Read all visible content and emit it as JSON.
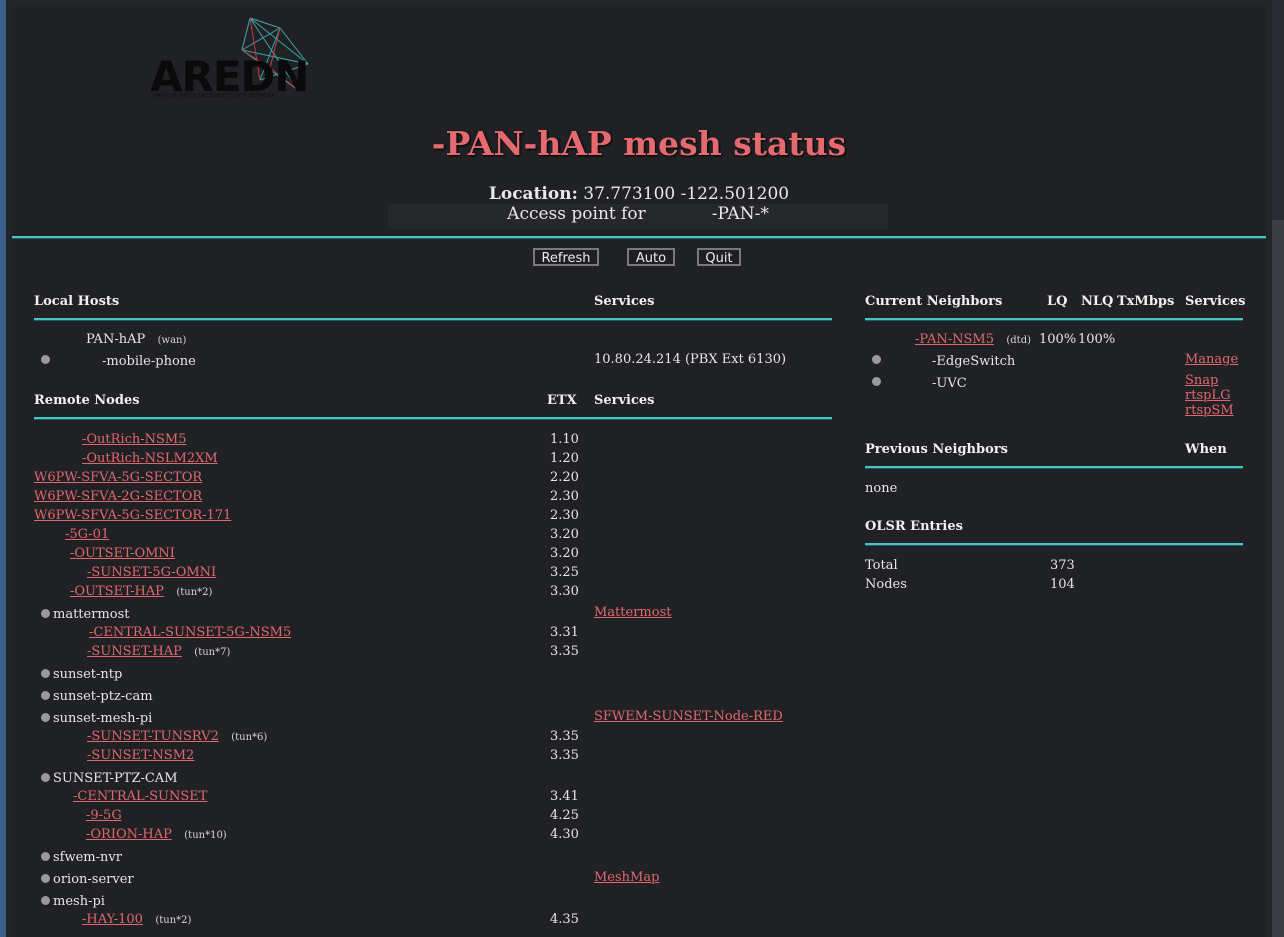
{
  "logo": {
    "name": "AREDN",
    "tagline": "AMATEUR RADIO EMERGENCY DATA NETWORK"
  },
  "title": {
    "prefix": "",
    "text": "-PAN-hAP mesh status"
  },
  "location": {
    "label": "Location:",
    "value": "37.773100 -122.501200"
  },
  "access_point": {
    "label": "Access point for",
    "value": "-PAN-*"
  },
  "buttons": {
    "refresh": "Refresh",
    "auto": "Auto",
    "quit": "Quit"
  },
  "local_hosts": {
    "header": "Local Hosts",
    "services_header": "Services",
    "node": {
      "name": "PAN-hAP",
      "tag": "(wan)"
    },
    "hosts": [
      {
        "name": "-mobile-phone",
        "service": "10.80.24.214 (PBX Ext 6130)"
      }
    ]
  },
  "remote_nodes": {
    "header": "Remote Nodes",
    "etx_header": "ETX",
    "services_header": "Services",
    "rows": [
      {
        "name": "-OutRich-NSM5",
        "etx": "1.10"
      },
      {
        "name": "-OutRich-NSLM2XM",
        "etx": "1.20"
      },
      {
        "name": "W6PW-SFVA-5G-SECTOR",
        "etx": "2.20"
      },
      {
        "name": "W6PW-SFVA-2G-SECTOR",
        "etx": "2.30"
      },
      {
        "name": "W6PW-SFVA-5G-SECTOR-171",
        "etx": "2.30"
      },
      {
        "name": "-5G-01",
        "etx": "3.20"
      },
      {
        "name": "-OUTSET-OMNI",
        "etx": "3.20"
      },
      {
        "name": "-SUNSET-5G-OMNI",
        "etx": "3.25"
      },
      {
        "name": "-OUTSET-HAP",
        "tag": "(tun*2)",
        "etx": "3.30"
      },
      {
        "host": "mattermost",
        "service": "Mattermost"
      },
      {
        "name": "-CENTRAL-SUNSET-5G-NSM5",
        "etx": "3.31"
      },
      {
        "name": "-SUNSET-HAP",
        "tag": "(tun*7)",
        "etx": "3.35"
      },
      {
        "host": "sunset-ntp"
      },
      {
        "host": "sunset-ptz-cam"
      },
      {
        "host": "sunset-mesh-pi",
        "service": "SFWEM-SUNSET-Node-RED"
      },
      {
        "name": "-SUNSET-TUNSRV2",
        "tag": "(tun*6)",
        "etx": "3.35"
      },
      {
        "name": "-SUNSET-NSM2",
        "etx": "3.35"
      },
      {
        "host": "SUNSET-PTZ-CAM"
      },
      {
        "name": "-CENTRAL-SUNSET",
        "etx": "3.41"
      },
      {
        "name": "-9-5G",
        "etx": "4.25"
      },
      {
        "name": "-ORION-HAP",
        "tag": "(tun*10)",
        "etx": "4.30"
      },
      {
        "host": "sfwem-nvr"
      },
      {
        "host": "orion-server",
        "service": "MeshMap"
      },
      {
        "host": "mesh-pi"
      },
      {
        "name": "-HAY-100",
        "tag": "(tun*2)",
        "etx": "4.35"
      }
    ]
  },
  "neighbors": {
    "header": "Current Neighbors",
    "lq_header": "LQ",
    "nlq_header": "NLQ",
    "tx_header": "TxMbps",
    "services_header": "Services",
    "node": {
      "name": "-PAN-NSM5",
      "tag": "(dtd)",
      "lq": "100%",
      "nlq": "100%"
    },
    "hosts": [
      {
        "name": "-EdgeSwitch",
        "services": [
          "Manage"
        ]
      },
      {
        "name": "-UVC",
        "services": [
          "Snap",
          "rtspLG",
          "rtspSM"
        ]
      }
    ]
  },
  "previous_neighbors": {
    "header": "Previous Neighbors",
    "when_header": "When",
    "value": "none"
  },
  "olsr": {
    "header": "OLSR Entries",
    "rows": [
      {
        "label": "Total",
        "value": "373"
      },
      {
        "label": "Nodes",
        "value": "104"
      }
    ]
  },
  "colors": {
    "accent": "#e46a70",
    "rule": "#48c4c4",
    "background": "#202124"
  }
}
